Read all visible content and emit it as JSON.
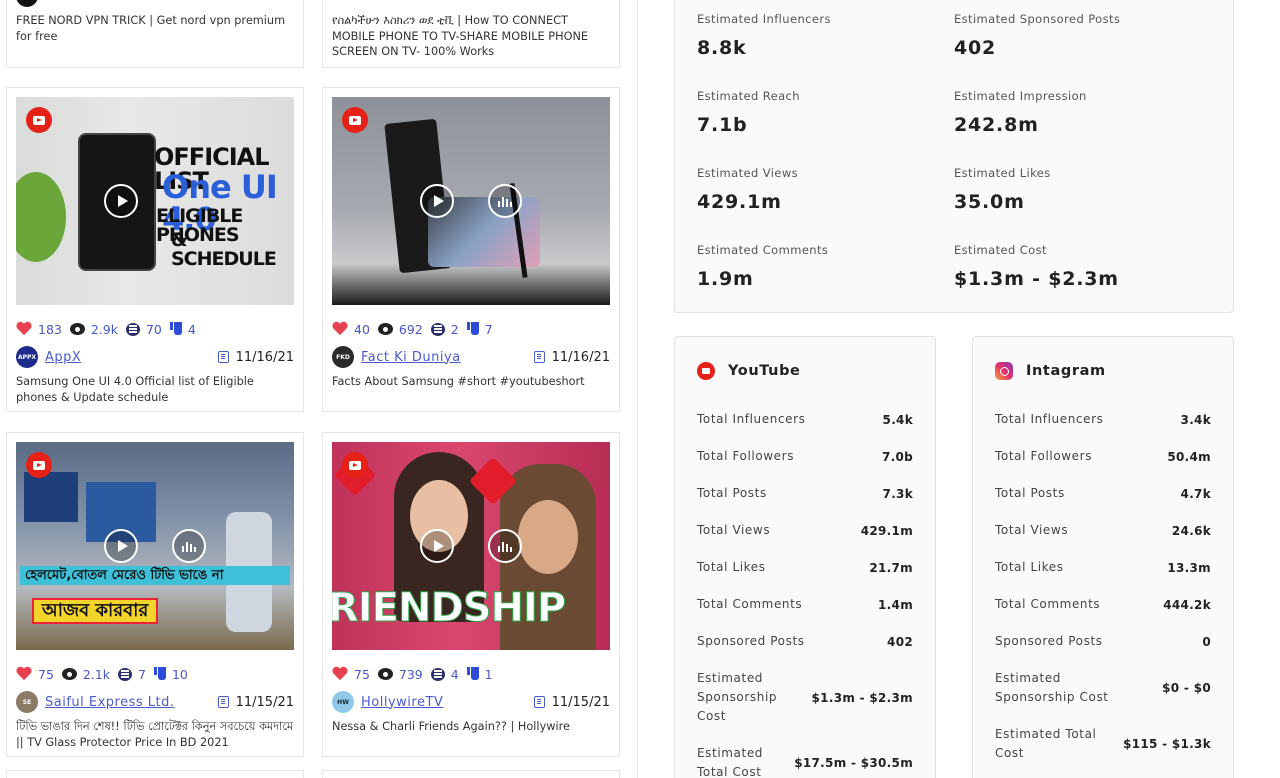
{
  "videos": [
    {
      "description": "FREE NORD VPN TRICK | Get nord vpn premium for free"
    },
    {
      "description": "የስልካችሁን እስክሪን ወደ ቲቪ | How TO CONNECT MOBILE PHONE TO TV-SHARE MOBILE PHONE SCREEN ON TV- 100% Works"
    },
    {
      "thumb_text_1": "OFFICIAL LIST",
      "thumb_text_2": "One UI 4.0",
      "thumb_text_3": "ELIGIBLE PHONES",
      "thumb_text_4": "& SCHEDULE",
      "likes": "183",
      "views": "2.9k",
      "comments": "70",
      "dislikes": "4",
      "channel": "AppX",
      "avatar_text": "APPX",
      "date": "11/16/21",
      "description": "Samsung One UI 4.0 Official list of Eligible phones & Update schedule"
    },
    {
      "likes": "40",
      "views": "692",
      "comments": "2",
      "dislikes": "7",
      "channel": "Fact Ki Duniya",
      "avatar_text": "FKD",
      "date": "11/16/21",
      "description": "Facts About Samsung #short #youtubeshort"
    },
    {
      "thumb_text_1": "হেলমেট,বোতল মেরেও টিভি ভাঙে না",
      "thumb_text_2": "আজব কারবার",
      "likes": "75",
      "views": "2.1k",
      "comments": "7",
      "dislikes": "10",
      "channel": "Saiful Express Ltd.",
      "avatar_text": "SE",
      "date": "11/15/21",
      "description": "টিভি ভাঙার দিন শেষ!! টিভি প্রোটেক্টর কিনুন সবচেয়ে কমদামে || TV Glass Protector Price In BD 2021"
    },
    {
      "thumb_text_1": "RIENDSHIP",
      "likes": "75",
      "views": "739",
      "comments": "4",
      "dislikes": "1",
      "channel": "HollywireTV",
      "avatar_text": "HW",
      "date": "11/15/21",
      "description": "Nessa & Charli Friends Again?? | Hollywire"
    }
  ],
  "estimates": [
    {
      "label": "Estimated Influencers",
      "value": "8.8k"
    },
    {
      "label": "Estimated Sponsored Posts",
      "value": "402"
    },
    {
      "label": "Estimated Reach",
      "value": "7.1b"
    },
    {
      "label": "Estimated Impression",
      "value": "242.8m"
    },
    {
      "label": "Estimated Views",
      "value": "429.1m"
    },
    {
      "label": "Estimated Likes",
      "value": "35.0m"
    },
    {
      "label": "Estimated Comments",
      "value": "1.9m"
    },
    {
      "label": "Estimated Cost",
      "value": "$1.3m - $2.3m"
    }
  ],
  "youtube": {
    "title": "YouTube",
    "rows": [
      {
        "label": "Total Influencers",
        "value": "5.4k"
      },
      {
        "label": "Total Followers",
        "value": "7.0b"
      },
      {
        "label": "Total Posts",
        "value": "7.3k"
      },
      {
        "label": "Total Views",
        "value": "429.1m"
      },
      {
        "label": "Total Likes",
        "value": "21.7m"
      },
      {
        "label": "Total Comments",
        "value": "1.4m"
      },
      {
        "label": "Sponsored Posts",
        "value": "402"
      },
      {
        "label": "Estimated Sponsorship Cost",
        "value": "$1.3m - $2.3m"
      },
      {
        "label": "Estimated Total Cost",
        "value": "$17.5m - $30.5m"
      }
    ]
  },
  "instagram": {
    "title": "Intagram",
    "rows": [
      {
        "label": "Total Influencers",
        "value": "3.4k"
      },
      {
        "label": "Total Followers",
        "value": "50.4m"
      },
      {
        "label": "Total Posts",
        "value": "4.7k"
      },
      {
        "label": "Total Views",
        "value": "24.6k"
      },
      {
        "label": "Total Likes",
        "value": "13.3m"
      },
      {
        "label": "Total Comments",
        "value": "444.2k"
      },
      {
        "label": "Sponsored Posts",
        "value": "0"
      },
      {
        "label": "Estimated Sponsorship Cost",
        "value": "$0 - $0"
      },
      {
        "label": "Estimated Total Cost",
        "value": "$115 - $1.3k"
      }
    ]
  },
  "colors": {
    "accent_blue": "#4a5bd0",
    "heart_red": "#e8414f",
    "youtube_red": "#e62117"
  }
}
